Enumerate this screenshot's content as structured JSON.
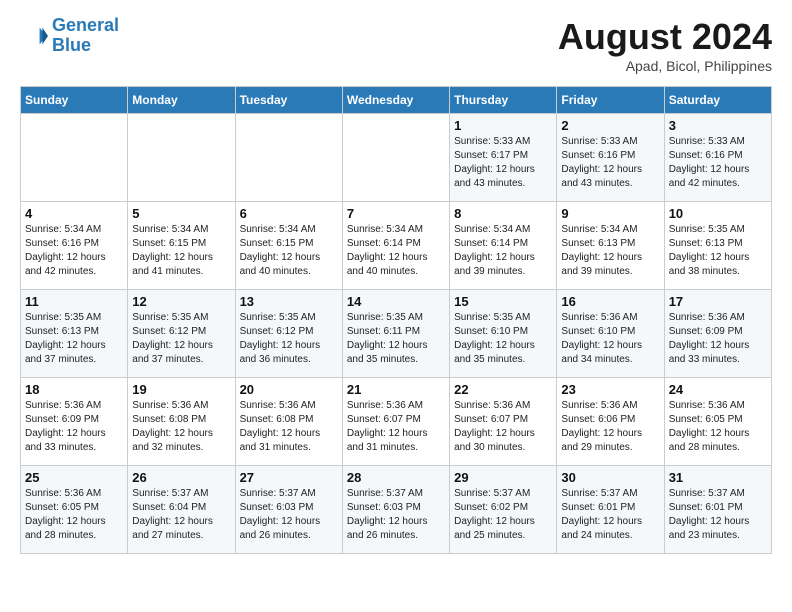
{
  "logo": {
    "line1": "General",
    "line2": "Blue"
  },
  "title": "August 2024",
  "subtitle": "Apad, Bicol, Philippines",
  "days_of_week": [
    "Sunday",
    "Monday",
    "Tuesday",
    "Wednesday",
    "Thursday",
    "Friday",
    "Saturday"
  ],
  "weeks": [
    [
      {
        "day": "",
        "info": ""
      },
      {
        "day": "",
        "info": ""
      },
      {
        "day": "",
        "info": ""
      },
      {
        "day": "",
        "info": ""
      },
      {
        "day": "1",
        "info": "Sunrise: 5:33 AM\nSunset: 6:17 PM\nDaylight: 12 hours\nand 43 minutes."
      },
      {
        "day": "2",
        "info": "Sunrise: 5:33 AM\nSunset: 6:16 PM\nDaylight: 12 hours\nand 43 minutes."
      },
      {
        "day": "3",
        "info": "Sunrise: 5:33 AM\nSunset: 6:16 PM\nDaylight: 12 hours\nand 42 minutes."
      }
    ],
    [
      {
        "day": "4",
        "info": "Sunrise: 5:34 AM\nSunset: 6:16 PM\nDaylight: 12 hours\nand 42 minutes."
      },
      {
        "day": "5",
        "info": "Sunrise: 5:34 AM\nSunset: 6:15 PM\nDaylight: 12 hours\nand 41 minutes."
      },
      {
        "day": "6",
        "info": "Sunrise: 5:34 AM\nSunset: 6:15 PM\nDaylight: 12 hours\nand 40 minutes."
      },
      {
        "day": "7",
        "info": "Sunrise: 5:34 AM\nSunset: 6:14 PM\nDaylight: 12 hours\nand 40 minutes."
      },
      {
        "day": "8",
        "info": "Sunrise: 5:34 AM\nSunset: 6:14 PM\nDaylight: 12 hours\nand 39 minutes."
      },
      {
        "day": "9",
        "info": "Sunrise: 5:34 AM\nSunset: 6:13 PM\nDaylight: 12 hours\nand 39 minutes."
      },
      {
        "day": "10",
        "info": "Sunrise: 5:35 AM\nSunset: 6:13 PM\nDaylight: 12 hours\nand 38 minutes."
      }
    ],
    [
      {
        "day": "11",
        "info": "Sunrise: 5:35 AM\nSunset: 6:13 PM\nDaylight: 12 hours\nand 37 minutes."
      },
      {
        "day": "12",
        "info": "Sunrise: 5:35 AM\nSunset: 6:12 PM\nDaylight: 12 hours\nand 37 minutes."
      },
      {
        "day": "13",
        "info": "Sunrise: 5:35 AM\nSunset: 6:12 PM\nDaylight: 12 hours\nand 36 minutes."
      },
      {
        "day": "14",
        "info": "Sunrise: 5:35 AM\nSunset: 6:11 PM\nDaylight: 12 hours\nand 35 minutes."
      },
      {
        "day": "15",
        "info": "Sunrise: 5:35 AM\nSunset: 6:10 PM\nDaylight: 12 hours\nand 35 minutes."
      },
      {
        "day": "16",
        "info": "Sunrise: 5:36 AM\nSunset: 6:10 PM\nDaylight: 12 hours\nand 34 minutes."
      },
      {
        "day": "17",
        "info": "Sunrise: 5:36 AM\nSunset: 6:09 PM\nDaylight: 12 hours\nand 33 minutes."
      }
    ],
    [
      {
        "day": "18",
        "info": "Sunrise: 5:36 AM\nSunset: 6:09 PM\nDaylight: 12 hours\nand 33 minutes."
      },
      {
        "day": "19",
        "info": "Sunrise: 5:36 AM\nSunset: 6:08 PM\nDaylight: 12 hours\nand 32 minutes."
      },
      {
        "day": "20",
        "info": "Sunrise: 5:36 AM\nSunset: 6:08 PM\nDaylight: 12 hours\nand 31 minutes."
      },
      {
        "day": "21",
        "info": "Sunrise: 5:36 AM\nSunset: 6:07 PM\nDaylight: 12 hours\nand 31 minutes."
      },
      {
        "day": "22",
        "info": "Sunrise: 5:36 AM\nSunset: 6:07 PM\nDaylight: 12 hours\nand 30 minutes."
      },
      {
        "day": "23",
        "info": "Sunrise: 5:36 AM\nSunset: 6:06 PM\nDaylight: 12 hours\nand 29 minutes."
      },
      {
        "day": "24",
        "info": "Sunrise: 5:36 AM\nSunset: 6:05 PM\nDaylight: 12 hours\nand 28 minutes."
      }
    ],
    [
      {
        "day": "25",
        "info": "Sunrise: 5:36 AM\nSunset: 6:05 PM\nDaylight: 12 hours\nand 28 minutes."
      },
      {
        "day": "26",
        "info": "Sunrise: 5:37 AM\nSunset: 6:04 PM\nDaylight: 12 hours\nand 27 minutes."
      },
      {
        "day": "27",
        "info": "Sunrise: 5:37 AM\nSunset: 6:03 PM\nDaylight: 12 hours\nand 26 minutes."
      },
      {
        "day": "28",
        "info": "Sunrise: 5:37 AM\nSunset: 6:03 PM\nDaylight: 12 hours\nand 26 minutes."
      },
      {
        "day": "29",
        "info": "Sunrise: 5:37 AM\nSunset: 6:02 PM\nDaylight: 12 hours\nand 25 minutes."
      },
      {
        "day": "30",
        "info": "Sunrise: 5:37 AM\nSunset: 6:01 PM\nDaylight: 12 hours\nand 24 minutes."
      },
      {
        "day": "31",
        "info": "Sunrise: 5:37 AM\nSunset: 6:01 PM\nDaylight: 12 hours\nand 23 minutes."
      }
    ]
  ]
}
